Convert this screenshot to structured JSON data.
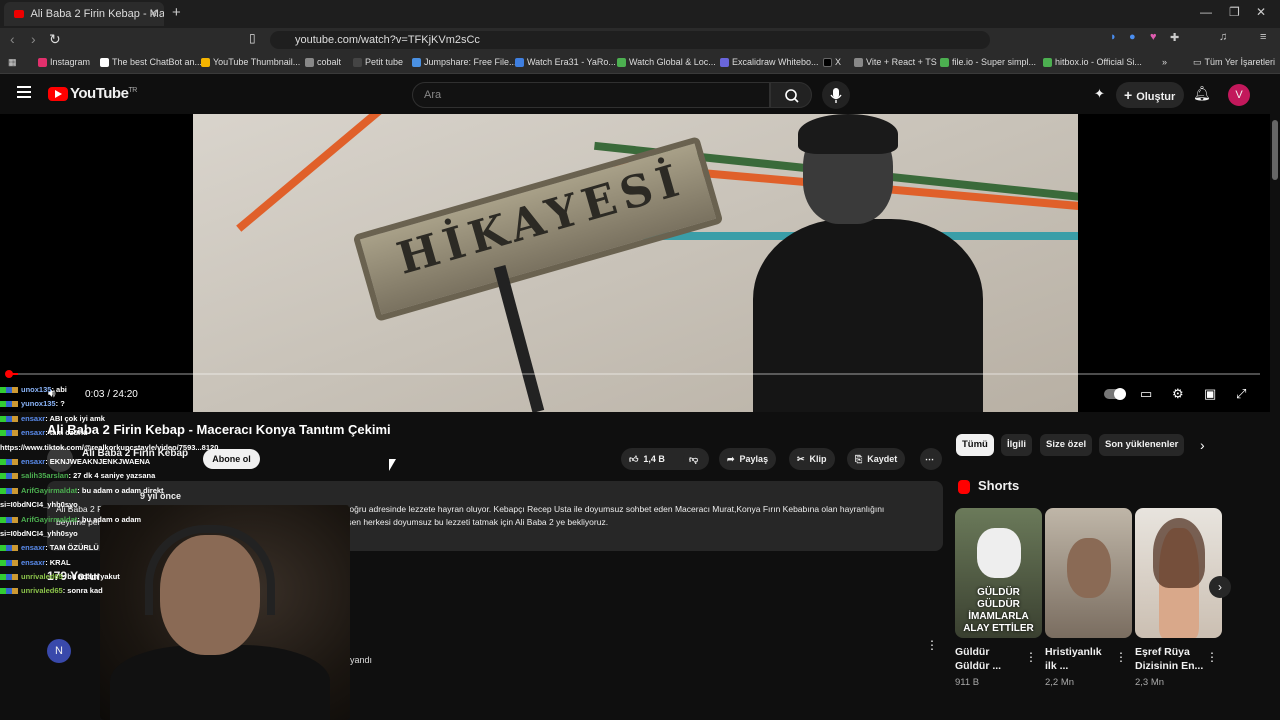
{
  "browser": {
    "tab_title": "Ali Baba 2 Firin Kebap - Mace",
    "url": "youtube.com/watch?v=TFKjKVm2sCc",
    "bookmarks": [
      {
        "label": "Instagram",
        "color": "#e1306c"
      },
      {
        "label": "The best ChatBot an...",
        "color": "#ffffff"
      },
      {
        "label": "YouTube Thumbnail...",
        "color": "#f4b400"
      },
      {
        "label": "cobalt",
        "color": "#888888"
      },
      {
        "label": "Petit tube",
        "color": "#444444"
      },
      {
        "label": "Jumpshare: Free File...",
        "color": "#4a90e2"
      },
      {
        "label": "Watch Era31 - YaRo...",
        "color": "#3f7fe0"
      },
      {
        "label": "Watch Global & Loc...",
        "color": "#4caf50"
      },
      {
        "label": "Excalidraw Whitebo...",
        "color": "#6965db"
      },
      {
        "label": "X",
        "color": "#000000"
      },
      {
        "label": "Vite + React + TS",
        "color": "#888888"
      },
      {
        "label": "file.io - Super simpl...",
        "color": "#4caf50"
      },
      {
        "label": "hitbox.io - Official Si...",
        "color": "#4caf50"
      }
    ],
    "bookmarks_overflow": "»",
    "all_bookmarks": "Tüm Yer İşaretleri"
  },
  "youtube": {
    "logo": "YouTube",
    "logo_region": "TR",
    "search_placeholder": "Ara",
    "create_label": "Oluştur",
    "avatar_letter": "V"
  },
  "video": {
    "sign_text": "HİKAYESİ",
    "time_current": "0:03",
    "time_total": "24:20",
    "time_display": "0:03 / 24:20",
    "progress_fraction": 0.0021
  },
  "details": {
    "title": "Ali Baba 2 Firin Kebap - Maceracı Konya Tanıtım Çekimi",
    "channel": "Ali Baba 2 Firin Kebap",
    "subscribe": "Abone ol",
    "likes": "1,4 B",
    "share": "Paylaş",
    "clip": "Klip",
    "save": "Kaydet",
    "meta": "9 yıl önce",
    "description": "Ali Baba 2 Firin Kebap Salonuna yolu düşen Maceracı Murat, Fırın Kebap ın doğru adresinde lezzete hayran oluyor. Kebapçı Recep Usta ile doyumsuz sohbet eden Maceracı Murat,Konya Fırın Kebabına olan hayranlığını beynine perçinleyen tüm aşamaları izleyenler ile paylaşıyor. Yolu Konya'ya düşen herkesi doyumsuz bu lezzeti tatmak için Ali Baba 2 ye bekliyoruz.",
    "comments_count": "179 Yorum",
    "comment_avatar": "N",
    "comment_fragment": "ayandı"
  },
  "chat": [
    {
      "user": "unox135",
      "msg": ": abi",
      "color": "#8ab4f8"
    },
    {
      "user": "yunox135",
      "msg": ": ?",
      "color": "#8ab4f8"
    },
    {
      "user": "ensaxr",
      "msg": ": ABI çok iyi amk",
      "color": "#5b8def"
    },
    {
      "user": "ensaxr",
      "msg": ": tam özürlü",
      "color": "#5b8def"
    },
    {
      "user": "https://www.tiktok.com/@realkorkuncstayle/video/7593...8120",
      "msg": "",
      "color": "#ffffff"
    },
    {
      "user": "ensaxr",
      "msg": ": EKNJWEAKNJENKJWAENA",
      "color": "#5b8def"
    },
    {
      "user": "salih35arslan",
      "msg": ": 27 dk 4 saniye yazsana",
      "color": "#4caf50"
    },
    {
      "user": "ArifGayirmaldat",
      "msg": ": bu adam o adam direkt",
      "color": "#4caf50"
    },
    {
      "user": "si=I0bdNCI4_yhh0syo",
      "msg": "",
      "color": "#ffffff"
    },
    {
      "user": "ArifGayirmaldat",
      "msg": ": bu adam o adam",
      "color": "#4caf50"
    },
    {
      "user": "si=I0bdNCI4_yhh0syo",
      "msg": "",
      "color": "#ffffff"
    },
    {
      "user": "ensaxr",
      "msg": ": TAM ÖZÜRLÜ",
      "color": "#5b8def"
    },
    {
      "user": "ensaxr",
      "msg": ": KRAL",
      "color": "#5b8def"
    },
    {
      "user": "unrivaled65",
      "msg": ": bu adam yakut",
      "color": "#8bc34a"
    },
    {
      "user": "unrivaled65",
      "msg": ": sonra kad",
      "color": "#8bc34a"
    }
  ],
  "sidebar": {
    "chips": [
      "Tümü",
      "İlgili",
      "Size özel",
      "Son yüklenenler"
    ],
    "shorts_heading": "Shorts",
    "shorts": [
      {
        "title": "Güldür Güldür ...",
        "views": "911 B",
        "caption": "GÜLDÜR GÜLDÜR İMAMLARLA ALAY ETTİLER"
      },
      {
        "title": "Hristiyanlık ilk ...",
        "views": "2,2 Mn",
        "caption": ""
      },
      {
        "title": "Eşref Rüya Dizisinin En...",
        "views": "2,3 Mn",
        "caption": ""
      }
    ]
  }
}
